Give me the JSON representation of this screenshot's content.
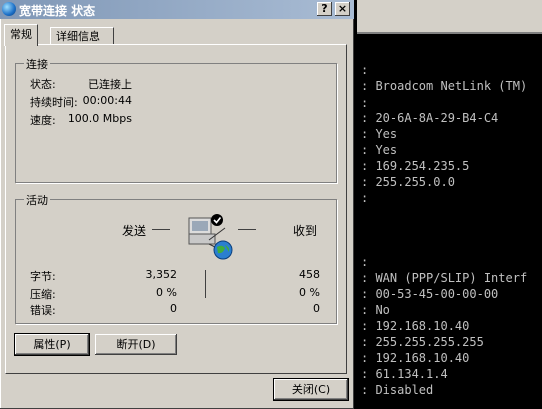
{
  "window": {
    "title": "宽带连接 状态",
    "help_button": "?",
    "close_button": "×"
  },
  "tabs": [
    {
      "label": "常规"
    },
    {
      "label": "详细信息"
    }
  ],
  "connection": {
    "group_label": "连接",
    "status_label": "状态:",
    "status_value": "已连接上",
    "duration_label": "持续时间:",
    "duration_value": "00:00:44",
    "speed_label": "速度:",
    "speed_value": "100.0 Mbps"
  },
  "activity": {
    "group_label": "活动",
    "sent_label": "发送",
    "received_label": "收到",
    "bytes_label": "字节:",
    "bytes_sent": "3,352",
    "bytes_received": "458",
    "compression_label": "压缩:",
    "compression_sent": "0 %",
    "compression_received": "0 %",
    "errors_label": "错误:",
    "errors_sent": "0",
    "errors_received": "0"
  },
  "buttons": {
    "properties": "属性(P)",
    "disconnect": "断开(D)",
    "close": "关闭(C)"
  },
  "console": {
    "lines": [
      ":",
      ": Broadcom NetLink (TM)",
      ":",
      ": 20-6A-8A-29-B4-C4",
      ": Yes",
      ": Yes",
      ": 169.254.235.5",
      ": 255.255.0.0",
      ":",
      ":",
      ": WAN (PPP/SLIP) Interf",
      ": 00-53-45-00-00-00",
      ": No",
      ": 192.168.10.40",
      ": 255.255.255.255",
      ": 192.168.10.40",
      ": 61.134.1.4",
      ": Disabled"
    ]
  }
}
